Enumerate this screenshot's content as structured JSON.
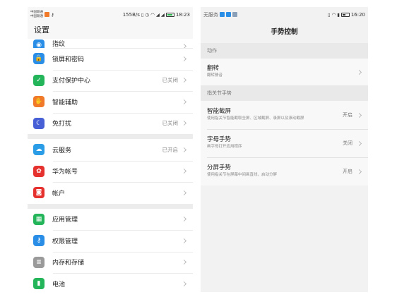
{
  "left": {
    "status": {
      "carrier1": "中国联通",
      "carrier2": "中国联通",
      "speed": "155B/s",
      "battery_level": 0.85,
      "time": "18:23"
    },
    "title": "设置",
    "groups": [
      [
        {
          "label": "指纹",
          "icon": "fingerprint-icon",
          "color": "#2a8ee6",
          "value": "",
          "partial": true
        },
        {
          "label": "锁屏和密码",
          "icon": "lock-icon",
          "color": "#2a8ee6",
          "value": ""
        },
        {
          "label": "支付保护中心",
          "icon": "shield-check-icon",
          "color": "#24b55a",
          "value": "已关闭"
        },
        {
          "label": "智能辅助",
          "icon": "hand-icon",
          "color": "#f07a2a",
          "value": ""
        },
        {
          "label": "免打扰",
          "icon": "moon-icon",
          "color": "#4760d6",
          "value": "已关闭"
        }
      ],
      [
        {
          "label": "云服务",
          "icon": "cloud-icon",
          "color": "#2a9de6",
          "value": "已开启"
        },
        {
          "label": "华为帐号",
          "icon": "huawei-logo-icon",
          "color": "#e6322e",
          "value": ""
        },
        {
          "label": "帐户",
          "icon": "account-icon",
          "color": "#e6322e",
          "value": ""
        }
      ],
      [
        {
          "label": "应用管理",
          "icon": "apps-grid-icon",
          "color": "#24b55a",
          "value": ""
        },
        {
          "label": "权限管理",
          "icon": "key-icon",
          "color": "#2a8ee6",
          "value": ""
        },
        {
          "label": "内存和存储",
          "icon": "storage-icon",
          "color": "#9a9a9a",
          "value": ""
        },
        {
          "label": "电池",
          "icon": "battery-icon",
          "color": "#24b55a",
          "value": ""
        }
      ]
    ]
  },
  "right": {
    "status": {
      "left_text": "无服务",
      "battery_level": 0.45,
      "time": "16:20"
    },
    "title": "手势控制",
    "sections": [
      {
        "header": "动作",
        "items": [
          {
            "title": "翻转",
            "subtitle": "翻转静音",
            "value": ""
          }
        ]
      },
      {
        "header": "指关节手势",
        "items": [
          {
            "title": "智能截屏",
            "subtitle": "使用指关节智能截取全屏、区域截屏、录屏以及滚动截屏",
            "value": "开启"
          },
          {
            "title": "字母手势",
            "subtitle": "画字母打开应用程序",
            "value": "关闭"
          },
          {
            "title": "分屏手势",
            "subtitle": "使用指关节在屏幕中间画直线，启动分屏",
            "value": "开启"
          }
        ]
      }
    ]
  }
}
